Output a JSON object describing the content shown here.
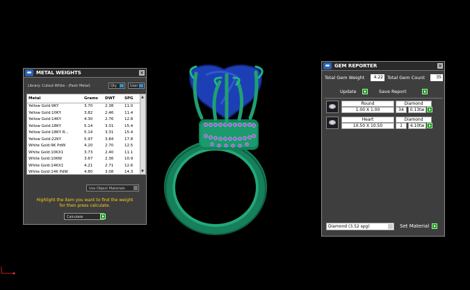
{
  "metal_weights": {
    "title": "METAL WEIGHTS",
    "library": "Library: Cutout White - (Fastr Metal)",
    "qty_label": "Qty",
    "user_label": "User",
    "headers": [
      "Metal",
      "Grams",
      "DWT",
      "SPG"
    ],
    "rows": [
      [
        "Yellow Gold:9KY",
        "3.70",
        "2.38",
        "11.0"
      ],
      [
        "Yellow Gold:10KY",
        "3.82",
        "2.46",
        "11.4"
      ],
      [
        "Yellow Gold:14KY",
        "4.30",
        "2.76",
        "12.8"
      ],
      [
        "Yellow Gold:18KY",
        "5.14",
        "3.31",
        "15.4"
      ],
      [
        "Yellow Gold:18KY R...",
        "5.14",
        "3.31",
        "15.4"
      ],
      [
        "Yellow Gold:22KY",
        "5.97",
        "3.84",
        "17.8"
      ],
      [
        "White Gold:9K PdW",
        "4.20",
        "2.70",
        "12.5"
      ],
      [
        "White Gold:10KX1",
        "3.73",
        "2.40",
        "11.1"
      ],
      [
        "White Gold:10KW",
        "3.67",
        "2.36",
        "10.9"
      ],
      [
        "White Gold:14KX1",
        "4.21",
        "2.71",
        "12.6"
      ],
      [
        "White Gold:14K PdW",
        "4.80",
        "3.08",
        "14.3"
      ]
    ],
    "use_object_materials": "Use Object Materials",
    "hint_line1": "Highlight the item you want to find the weight",
    "hint_line2": "for then press calculate.",
    "calculate": "Calculate"
  },
  "gem_reporter": {
    "title": "GEM REPORTER",
    "total_gem_weight_label": "Total Gem Weight",
    "total_gem_weight": "4.22",
    "total_gem_count_label": "Total Gem Count",
    "total_gem_count": "35",
    "update": "Update",
    "save_report": "Save Report",
    "gems": [
      {
        "shape": "Round",
        "material": "Diamond",
        "size": "1.00 X 1.00",
        "count": "34",
        "weight": "0.13tw"
      },
      {
        "shape": "Heart",
        "material": "Diamond",
        "size": "10.50 X 10.50",
        "count": "1",
        "weight": "4.10tw"
      }
    ],
    "material_select": "Diamond    (3.52 spg)",
    "set_material": "Set Material"
  },
  "colors": {
    "panel_bg": "#3e3e3e",
    "hint_yellow": "#ffd21a",
    "ring_green": "#1fa071",
    "gem_blue": "#1d3fb5",
    "accent_green_button": "#1f8f1f"
  }
}
